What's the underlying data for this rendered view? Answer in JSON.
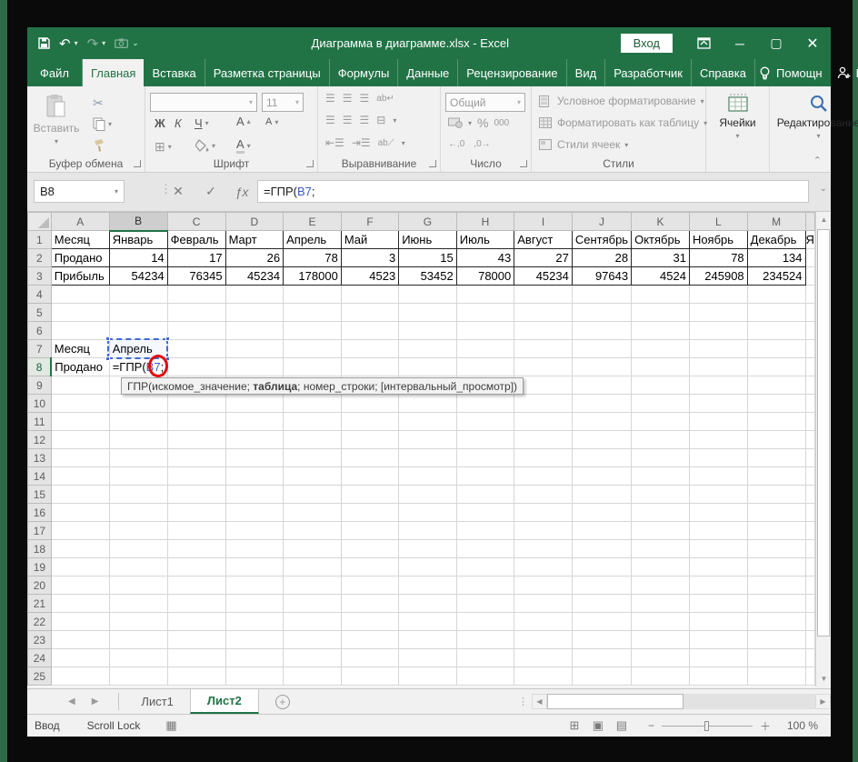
{
  "window": {
    "title": "Диаграмма в диаграмме.xlsx  -  Excel",
    "signin_label": "Вход"
  },
  "tabs": [
    {
      "id": "file",
      "label": "Файл",
      "active": false,
      "file": true
    },
    {
      "id": "home",
      "label": "Главная",
      "active": true
    },
    {
      "id": "insert",
      "label": "Вставка",
      "active": false
    },
    {
      "id": "page-layout",
      "label": "Разметка страницы",
      "active": false
    },
    {
      "id": "formulas",
      "label": "Формулы",
      "active": false
    },
    {
      "id": "data",
      "label": "Данные",
      "active": false
    },
    {
      "id": "review",
      "label": "Рецензирование",
      "active": false
    },
    {
      "id": "view",
      "label": "Вид",
      "active": false
    },
    {
      "id": "developer",
      "label": "Разработчик",
      "active": false
    },
    {
      "id": "help",
      "label": "Справка",
      "active": false
    }
  ],
  "tabbar_right": {
    "assistant": "Помощн",
    "share": "Поделиться"
  },
  "ribbon": {
    "paste_label": "Вставить",
    "font_size": "11",
    "bold": "Ж",
    "italic": "К",
    "underline": "Ч",
    "grow_font": "А",
    "shrink_font": "А",
    "number_format": "Общий",
    "percent": "%",
    "thousands": "000",
    "inc_decimal": "←,0",
    "dec_decimal": ",0→",
    "styles_items": [
      "Условное форматирование",
      "Форматировать как таблицу",
      "Стили ячеек"
    ],
    "group_labels": {
      "clipboard": "Буфер обмена",
      "font": "Шрифт",
      "alignment": "Выравнивание",
      "number": "Число",
      "styles": "Стили",
      "cells": "Ячейки",
      "editing": "Редактирование"
    }
  },
  "formula_bar": {
    "name_box": "B8",
    "cancel": "✕",
    "enter": "✓",
    "insert_function": "ƒx"
  },
  "grid": {
    "columns": [
      "A",
      "B",
      "C",
      "D",
      "E",
      "F",
      "G",
      "H",
      "I",
      "J",
      "K",
      "L",
      "M"
    ],
    "row_count": 25,
    "selected_column": "B",
    "selected_row": 8,
    "cells": {
      "1": [
        "Месяц",
        "Январь",
        "Февраль",
        "Март",
        "Апрель",
        "Май",
        "Июнь",
        "Июль",
        "Август",
        "Сентябрь",
        "Октябрь",
        "Ноябрь",
        "Декабрь",
        "Я"
      ],
      "2": [
        "Продано",
        14,
        17,
        26,
        78,
        3,
        15,
        43,
        27,
        28,
        31,
        78,
        134
      ],
      "3": [
        "Прибыль",
        54234,
        76345,
        45234,
        178000,
        4523,
        53452,
        78000,
        45234,
        97643,
        4524,
        245908,
        234524
      ],
      "7": [
        "Месяц",
        "Апрель"
      ],
      "8": [
        "Продано",
        null
      ]
    },
    "formula_cell": {
      "row": 8,
      "col": "B",
      "prefix": "=ГПР(",
      "ref": "B7",
      "suffix": ";"
    }
  },
  "tooltip": {
    "prefix": "ГПР(искомое_значение; ",
    "bold": "таблица",
    "suffix": "; номер_строки; [интервальный_просмотр])"
  },
  "sheet_tabs": [
    {
      "label": "Лист1",
      "active": false
    },
    {
      "label": "Лист2",
      "active": true
    }
  ],
  "status_bar": {
    "mode": "Ввод",
    "scroll_lock": "Scroll Lock",
    "zoom": "100 %"
  },
  "colors": {
    "excel_green": "#217346",
    "reference_blue": "#3b5bc4",
    "annotation_red": "#e00b0b"
  }
}
